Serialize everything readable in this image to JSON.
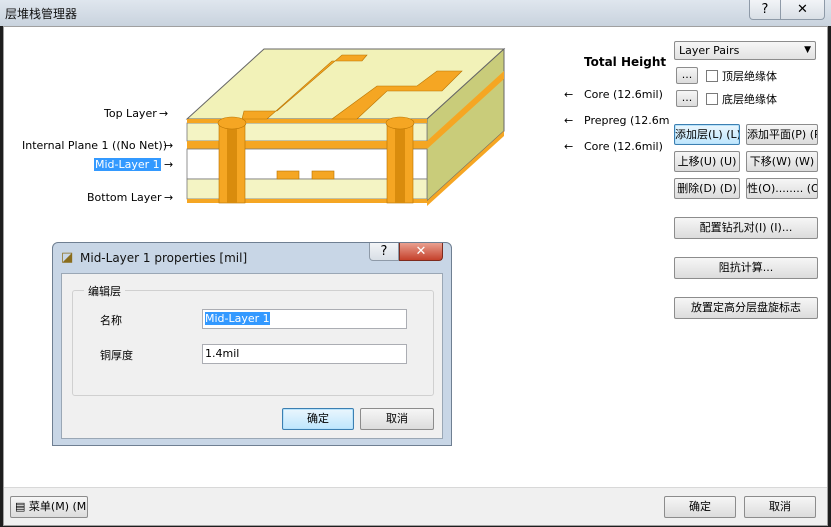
{
  "window": {
    "title": "层堆栈管理器",
    "help": "?",
    "close": "✕"
  },
  "diagram": {
    "labels_left": {
      "top_layer": "Top Layer",
      "internal_plane": "Internal Plane 1 ((No Net))",
      "mid_layer": "Mid-Layer 1",
      "bottom_layer": "Bottom Layer"
    },
    "labels_right": {
      "total_height": "Total Height",
      "core_top": "Core (12.6mil)",
      "prepreg": "Prepreg (12.6m",
      "core_bottom": "Core (12.6mil)"
    },
    "colors": {
      "copper": "#f5a623",
      "substrate": "#f4f4c4",
      "side": "#c9cc7a"
    }
  },
  "right_panel": {
    "layer_pairs": "Layer Pairs",
    "dots_button": "...",
    "top_dielectric": "顶层绝缘体",
    "bottom_dielectric": "底层绝缘体",
    "add_layer": "添加层(L) (L)",
    "add_plane": "添加平面(P) (P",
    "move_up": "上移(U) (U)",
    "move_down": "下移(W) (W)",
    "delete": "删除(D) (D)",
    "properties": "性(O)........ (O",
    "drill_pairs": "配置钻孔对(I) (I)...",
    "impedance": "阻抗计算...",
    "place_stack_legend": "放置定高分层盘旋标志"
  },
  "bottom": {
    "menu": "菜单(M) (M",
    "ok": "确定",
    "cancel": "取消"
  },
  "dialog": {
    "title": "Mid-Layer 1 properties [mil]",
    "help": "?",
    "close": "✕",
    "group_label": "编辑层",
    "name_label": "名称",
    "name_value": "Mid-Layer 1",
    "thickness_label": "铜厚度",
    "thickness_value": "1.4mil",
    "ok": "确定",
    "cancel": "取消"
  }
}
